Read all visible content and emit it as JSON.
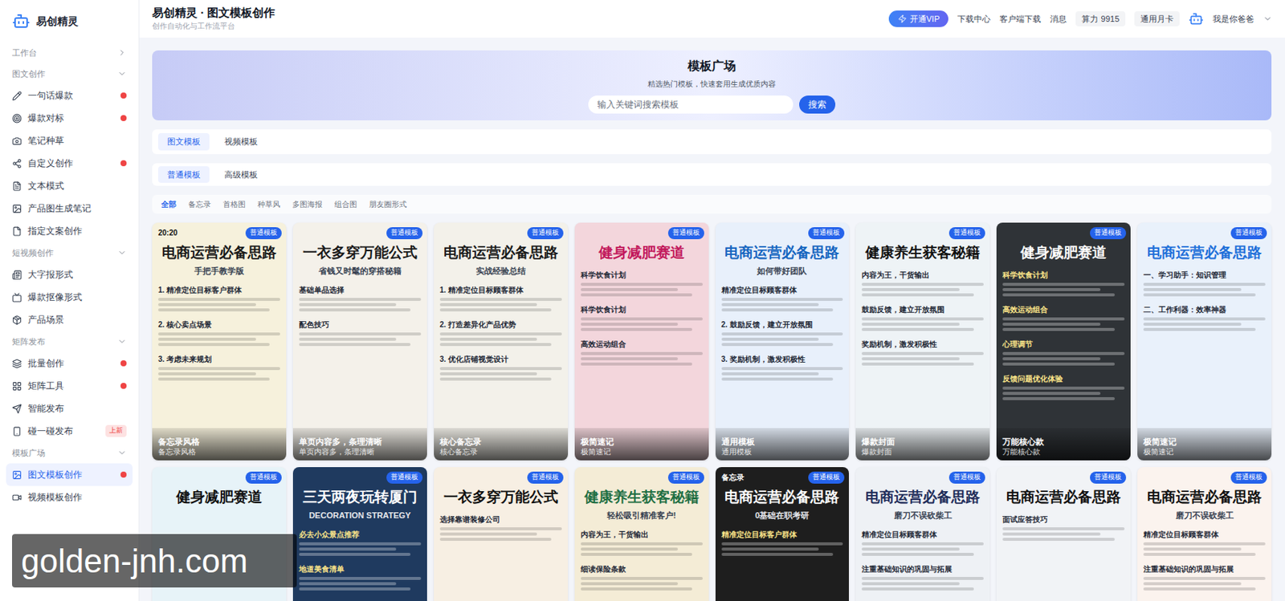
{
  "sidebar": {
    "logo": "易创精灵",
    "groups": [
      {
        "label": "工作台",
        "expanded": false,
        "items": []
      },
      {
        "label": "图文创作",
        "expanded": true,
        "items": [
          {
            "label": "一句话爆款",
            "dot": true,
            "selected": false
          },
          {
            "label": "爆款对标",
            "dot": true,
            "selected": false
          },
          {
            "label": "笔记种草",
            "dot": false,
            "selected": false
          },
          {
            "label": "自定义创作",
            "dot": true,
            "selected": false
          },
          {
            "label": "文本模式",
            "dot": false,
            "selected": false
          },
          {
            "label": "产品图生成笔记",
            "dot": false,
            "selected": false
          },
          {
            "label": "指定文案创作",
            "dot": false,
            "selected": false
          }
        ]
      },
      {
        "label": "短视频创作",
        "expanded": true,
        "items": [
          {
            "label": "大字报形式",
            "dot": false,
            "selected": false
          },
          {
            "label": "爆款抠像形式",
            "dot": false,
            "selected": false
          },
          {
            "label": "产品场景",
            "dot": false,
            "selected": false
          }
        ]
      },
      {
        "label": "矩阵发布",
        "expanded": true,
        "items": [
          {
            "label": "批量创作",
            "dot": true,
            "selected": false
          },
          {
            "label": "矩阵工具",
            "dot": true,
            "selected": false
          },
          {
            "label": "智能发布",
            "dot": false,
            "selected": false
          },
          {
            "label": "碰一碰发布",
            "dot": false,
            "selected": false,
            "badge": "上新"
          }
        ]
      },
      {
        "label": "模板广场",
        "expanded": true,
        "items": [
          {
            "label": "图文模板创作",
            "dot": true,
            "selected": true
          },
          {
            "label": "视频模板创作",
            "dot": false,
            "selected": false
          }
        ]
      }
    ]
  },
  "header": {
    "title": "易创精灵 · 图文模板创作",
    "subtitle": "创作自动化与工作流平台",
    "vip": "开通VIP",
    "links": [
      "下载中心",
      "客户端下载",
      "消息"
    ],
    "power": "算力 9915",
    "card": "通用月卡",
    "user": "我是你爸爸"
  },
  "banner": {
    "title": "模板广场",
    "subtitle": "精选热门模板，快速套用生成优质内容",
    "search": {
      "placeholder": "输入关键词搜索模板"
    },
    "button": "搜索"
  },
  "tabs": [
    {
      "label": "图文模板",
      "selected": true
    },
    {
      "label": "视频模板",
      "selected": false
    }
  ],
  "subtabs": [
    {
      "label": "普通模板",
      "selected": true
    },
    {
      "label": "高级模板",
      "selected": false
    }
  ],
  "categories": [
    {
      "label": "全部",
      "selected": true
    },
    {
      "label": "备忘录",
      "selected": false
    },
    {
      "label": "首格图",
      "selected": false
    },
    {
      "label": "种草风",
      "selected": false
    },
    {
      "label": "多图海报",
      "selected": false
    },
    {
      "label": "组合图",
      "selected": false
    },
    {
      "label": "朋友圈形式",
      "selected": false
    }
  ],
  "cards": [
    {
      "badge": "普通模板",
      "tag": "20:20",
      "title": "电商运营必备思路",
      "subtitle": "手把手教学版",
      "sections": [
        "1. 精准定位目标客户群体",
        "2. 核心卖点场景",
        "3. 考虑未来规划"
      ],
      "name": "备忘录风格",
      "desc": "备忘录风格",
      "kind": "light",
      "color": "#f6f1dc",
      "titleColor": "#1a1a1a"
    },
    {
      "badge": "普通模板",
      "title": "一衣多穿万能公式",
      "subtitle": "省钱又时髦的穿搭秘籍",
      "sections": [
        "基础单品选择",
        "配色技巧"
      ],
      "name": "单页内容多，条理清晰",
      "desc": "单页内容多，条理清晰",
      "kind": "light",
      "color": "#f4f1ea",
      "titleColor": "#1a1a1a"
    },
    {
      "badge": "普通模板",
      "title": "电商运营必备思路",
      "subtitle": "实战经验总结",
      "sections": [
        "1. 精准定位目标顾客群体",
        "2. 打造差异化产品优势",
        "3. 优化店铺视觉设计"
      ],
      "name": "核心备忘录",
      "desc": "核心备忘录",
      "kind": "light",
      "color": "#f3f1ea",
      "titleColor": "#1a1a1a"
    },
    {
      "badge": "普通模板",
      "title": "健身减肥赛道",
      "sections": [
        "科学饮食计划",
        "科学饮食计划",
        "高效运动组合"
      ],
      "name": "极简速记",
      "desc": "极简速记",
      "kind": "light",
      "color": "#f3d6dc",
      "titleColor": "#c2185b"
    },
    {
      "badge": "普通模板",
      "title": "电商运营必备思路",
      "subtitle": "如何带好团队",
      "sections": [
        "精准定位目标顾客群体",
        "2. 鼓励反馈，建立开放氛围",
        "3. 奖励机制，激发积极性"
      ],
      "name": "通用模板",
      "desc": "通用模板",
      "kind": "light",
      "color": "#e8f0fb",
      "titleColor": "#1565c0"
    },
    {
      "badge": "普通模板",
      "title": "健康养生获客秘籍",
      "sections": [
        "内容为王，干货输出",
        "鼓励反馈，建立开放氛围",
        "奖励机制，激发积极性"
      ],
      "name": "爆款封面",
      "desc": "爆款封面",
      "kind": "light",
      "color": "#eef3f6",
      "titleColor": "#111111"
    },
    {
      "badge": "普通模板",
      "title": "健身减肥赛道",
      "sections": [
        "科学饮食计划",
        "高效运动组合",
        "心理调节",
        "反馈问题优化体验"
      ],
      "name": "万能核心款",
      "desc": "万能核心款",
      "kind": "dark",
      "color": "#2f3337",
      "titleColor": "#ffffff"
    },
    {
      "badge": "普通模板",
      "title": "电商运营必备思路",
      "sections": [
        "一、学习助手：知识管理",
        "二、工作利器：效率神器"
      ],
      "name": "极简速记",
      "desc": "极简速记",
      "kind": "light",
      "color": "#e9f1fb",
      "titleColor": "#1e6fd9"
    },
    {
      "badge": "普通模板",
      "title": "健身减肥赛道",
      "sections": [],
      "kind": "light",
      "color": "#e7f3f8",
      "titleColor": "#111111"
    },
    {
      "badge": "普通模板",
      "title": "三天两夜玩转厦门",
      "subtitle": "DECORATION STRATEGY",
      "sections": [
        "必去小众景点推荐",
        "地道美食清单"
      ],
      "kind": "dark",
      "color": "#1f3a5f",
      "titleColor": "#ffffff"
    },
    {
      "badge": "普通模板",
      "title": "一衣多穿万能公式",
      "sections": [
        "选择靠谱装修公司"
      ],
      "kind": "light",
      "color": "#f7efe3",
      "titleColor": "#111111"
    },
    {
      "badge": "普通模板",
      "title": "健康养生获客秘籍",
      "subtitle": "轻松吸引精准客户!",
      "sections": [
        "内容为王，干货输出",
        "细读保险条款"
      ],
      "kind": "light",
      "color": "#f4ecd6",
      "titleColor": "#1f6f43"
    },
    {
      "badge": "普通模板",
      "tag": "备忘录",
      "title": "电商运营必备思路",
      "subtitle": "0基础在职考研",
      "sections": [
        "精准定位目标客户群体"
      ],
      "kind": "dark",
      "color": "#1e1e1e",
      "titleColor": "#ffffff"
    },
    {
      "badge": "普通模板",
      "title": "电商运营必备思路",
      "subtitle": "磨刀不误砍柴工",
      "sections": [
        "精准定位目标顾客群体",
        "注重基础知识的巩固与拓展"
      ],
      "kind": "light",
      "color": "#eef1f5",
      "titleColor": "#1f2d5a"
    },
    {
      "badge": "普通模板",
      "title": "电商运营必备思路",
      "sections": [
        "面试应答技巧"
      ],
      "kind": "light",
      "color": "#f1f3f6",
      "titleColor": "#111111"
    },
    {
      "badge": "普通模板",
      "title": "电商运营必备思路",
      "subtitle": "磨刀不误砍柴工",
      "sections": [
        "精准定位目标顾客群体",
        "注重基础知识的巩固与拓展"
      ],
      "kind": "light",
      "color": "#fbf3ee",
      "titleColor": "#111111"
    }
  ],
  "watermark": "golden-jnh.com"
}
